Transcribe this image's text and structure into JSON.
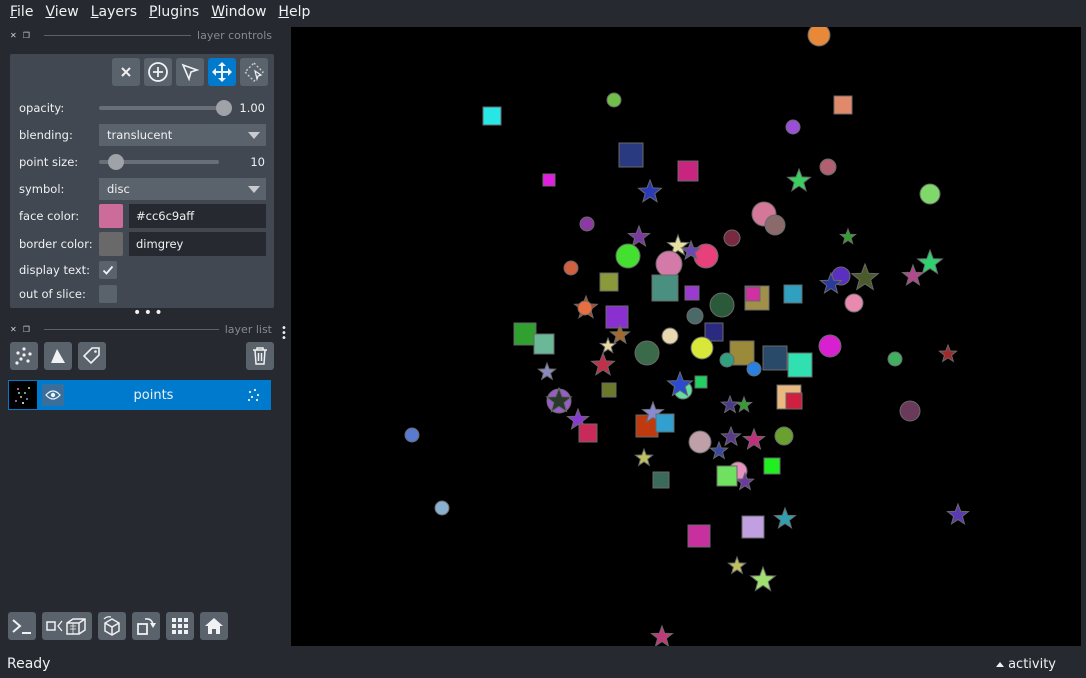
{
  "menu": [
    {
      "key": "F",
      "rest": "ile"
    },
    {
      "key": "V",
      "rest": "iew"
    },
    {
      "key": "L",
      "rest": "ayers"
    },
    {
      "key": "P",
      "rest": "lugins"
    },
    {
      "key": "W",
      "rest": "indow"
    },
    {
      "key": "H",
      "rest": "elp"
    }
  ],
  "layer_controls": {
    "title": "layer controls",
    "opacity": {
      "label": "opacity:",
      "value": "1.00",
      "fraction": 1.0
    },
    "blending": {
      "label": "blending:",
      "value": "translucent"
    },
    "point_size": {
      "label": "point size:",
      "value": "10",
      "fraction": 0.14
    },
    "symbol": {
      "label": "symbol:",
      "value": "disc"
    },
    "face_color": {
      "label": "face color:",
      "value": "#cc6c9aff",
      "color": "#cc6c9a"
    },
    "border_color": {
      "label": "border color:",
      "value": "dimgrey",
      "color": "#696969"
    },
    "display_text": {
      "label": "display text:",
      "checked": true
    },
    "out_of_slice": {
      "label": "out of slice:",
      "checked": false
    }
  },
  "layer_list": {
    "title": "layer list",
    "layers": [
      {
        "name": "points",
        "visible": true,
        "selected": true
      }
    ]
  },
  "status": {
    "text": "Ready",
    "activity": "activity"
  },
  "colors": {
    "accent": "#007acc",
    "background": "#262930",
    "panel": "#414851",
    "control": "#5a626c"
  }
}
